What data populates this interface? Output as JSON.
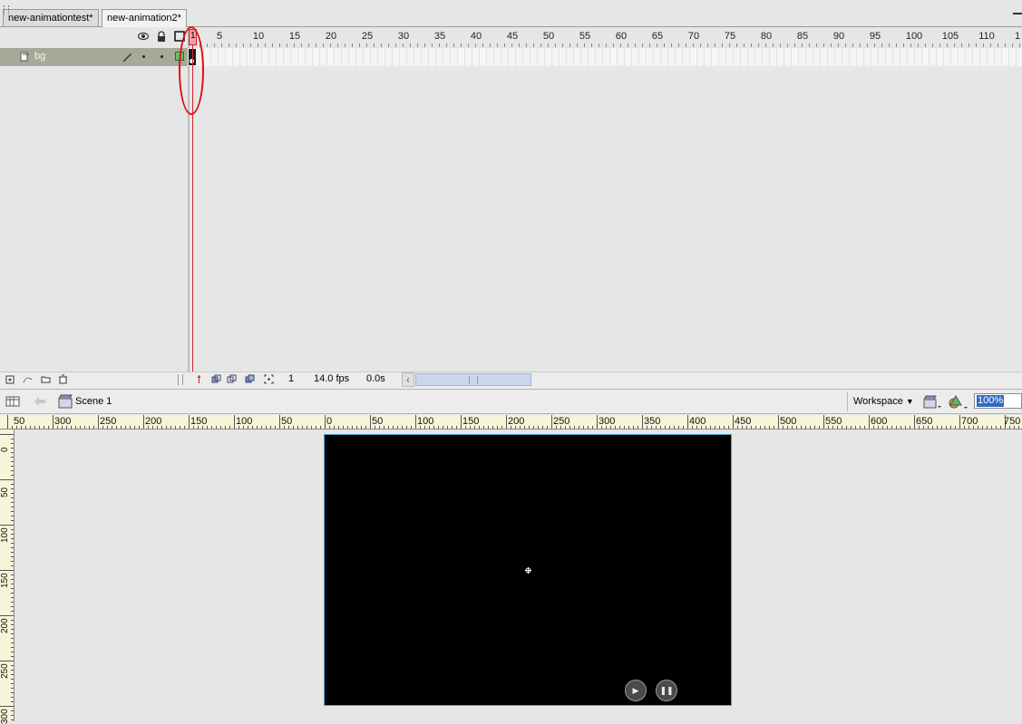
{
  "tabs": [
    {
      "label": "new-animationtest*",
      "active": false
    },
    {
      "label": "new-animation2*",
      "active": true
    }
  ],
  "timeline": {
    "header_icons": [
      "eye-icon",
      "lock-icon",
      "outline-icon"
    ],
    "frame_numbers": [
      "1",
      "5",
      "10",
      "15",
      "20",
      "25",
      "30",
      "35",
      "40",
      "45",
      "50",
      "55",
      "60",
      "65",
      "70",
      "75",
      "80",
      "85",
      "90",
      "95",
      "100",
      "105",
      "110",
      "1"
    ],
    "layers": [
      {
        "name": "bg"
      }
    ],
    "current_frame": "1",
    "fps": "14.0 fps",
    "elapsed": "0.0s"
  },
  "editbar": {
    "scene": "Scene 1",
    "workspace": "Workspace",
    "zoom": "100%"
  },
  "ruler_h": [
    "50",
    "300",
    "250",
    "200",
    "150",
    "100",
    "50",
    "0",
    "50",
    "100",
    "150",
    "200",
    "250",
    "300",
    "350",
    "400",
    "450",
    "500",
    "550",
    "600",
    "650",
    "700",
    "750"
  ],
  "ruler_v": [
    "0",
    "50",
    "100",
    "150",
    "200",
    "250",
    "300"
  ],
  "stage": {
    "background": "#000000",
    "buttons": [
      "play-button",
      "pause-button"
    ]
  },
  "colors": {
    "playhead": "#d2232a",
    "annotation": "#e01010",
    "selection": "#316ac5"
  }
}
